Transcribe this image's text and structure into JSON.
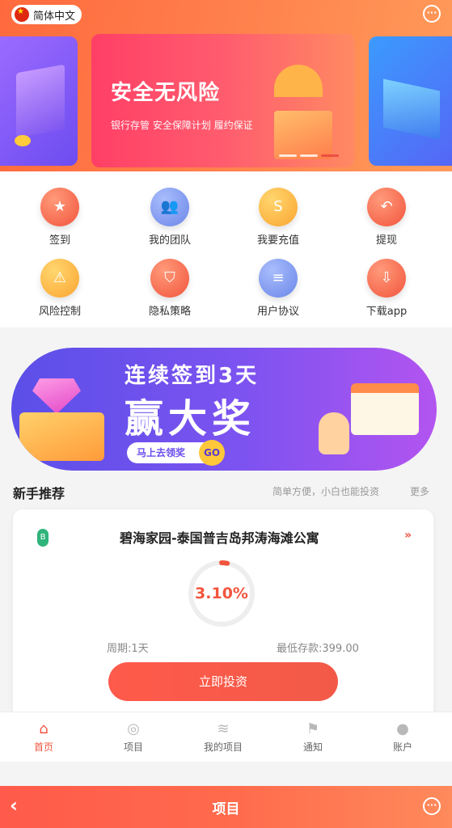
{
  "header": {
    "language": "简体中文",
    "chat_icon": "chat-bubble-icon"
  },
  "banner": {
    "title": "安全无风险",
    "subtitle": "银行存管 安全保障计划 履约保证",
    "dots": 3,
    "active_dot": 2
  },
  "grid": [
    {
      "label": "签到",
      "icon": "star-badge-icon",
      "color": "red",
      "glyph": "★"
    },
    {
      "label": "我的团队",
      "icon": "team-icon",
      "color": "blue",
      "glyph": "👥"
    },
    {
      "label": "我要充值",
      "icon": "recharge-icon",
      "color": "yellow",
      "glyph": "S"
    },
    {
      "label": "提现",
      "icon": "withdraw-icon",
      "color": "red",
      "glyph": "↶"
    },
    {
      "label": "风险控制",
      "icon": "warning-icon",
      "color": "yellow",
      "glyph": "⚠"
    },
    {
      "label": "隐私策略",
      "icon": "shield-icon",
      "color": "red",
      "glyph": "⛉"
    },
    {
      "label": "用户协议",
      "icon": "document-icon",
      "color": "blue",
      "glyph": "≡"
    },
    {
      "label": "下载app",
      "icon": "cloud-download-icon",
      "color": "red",
      "glyph": "⇩"
    }
  ],
  "promo": {
    "line1": "连续签到3天",
    "line2": "赢大奖",
    "cta": "马上去领奖",
    "go": "GO"
  },
  "section": {
    "title": "新手推荐",
    "subtitle": "简单方便，小白也能投资",
    "more": "更多"
  },
  "product": {
    "name": "碧海家园-泰国普吉岛邦涛海滩公寓",
    "rate": "3.10%",
    "progress": 0.03,
    "period": "周期:1天",
    "min_deposit": "最低存款:399.00",
    "invest_button": "立即投资",
    "badge": "B"
  },
  "tabs": [
    {
      "label": "首页",
      "icon": "home-icon",
      "active": true
    },
    {
      "label": "项目",
      "icon": "project-icon",
      "active": false
    },
    {
      "label": "我的项目",
      "icon": "coins-stack-icon",
      "active": false
    },
    {
      "label": "通知",
      "icon": "flag-icon",
      "active": false
    },
    {
      "label": "账户",
      "icon": "user-icon",
      "active": false
    }
  ],
  "appbar": {
    "title": "项目"
  },
  "colors": {
    "accent": "#f2553d",
    "promo_bg": "#6b4ef0",
    "gold": "#ffc83a"
  }
}
